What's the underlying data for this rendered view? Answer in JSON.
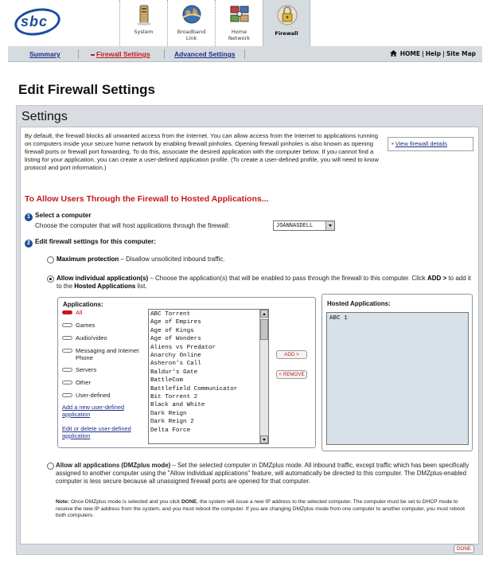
{
  "brand": {
    "logo_text": "sbc"
  },
  "topnav": {
    "items": [
      {
        "label": "System",
        "icon": "system-tower-icon"
      },
      {
        "label": "Broadband\nLink",
        "icon": "globe-icon"
      },
      {
        "label": "Home\nNetwork",
        "icon": "home-network-icon"
      },
      {
        "label": "Firewall",
        "icon": "padlock-icon",
        "active": true
      }
    ]
  },
  "subnav": {
    "summary": "Summary",
    "firewall_settings": "Firewall Settings",
    "advanced_settings": "Advanced Settings",
    "home": "HOME",
    "help": "Help",
    "site_map": "Site Map"
  },
  "page_title": "Edit Firewall Settings",
  "panel_title": "Settings",
  "intro": "By default, the firewall blocks all unwanted access from the Internet. You can allow access from the Internet to applications running on computers inside your secure home network by enabling firewall pinholes. Opening firewall pinholes is also known as opening firewall ports or firewall port forwarding. To do this, associate the desired application with the computer below. If you cannot find a listing for your application, you can create a user-defined application profile. (To create a user-defined profile, you will need to know protocol and port information.)",
  "view_details_link": "View firewall details",
  "section_heading": "To Allow Users Through the Firewall to Hosted Applications...",
  "step1": {
    "number": "1",
    "title": "Select a computer",
    "desc": "Choose the computer that will host applications through the firewall:",
    "selected_computer": "JOANNASDELL"
  },
  "step2": {
    "number": "2",
    "title": "Edit firewall settings for this computer:"
  },
  "options": {
    "max_protection": {
      "title": "Maximum protection",
      "desc": " – Disallow unsolicited inbound traffic."
    },
    "individual": {
      "title": "Allow individual application(s)",
      "desc": " – Choose the application(s) that will be enabled to pass through the firewall to this computer. Click ",
      "add_word": "ADD >",
      "desc2": " to add it to the ",
      "hosted_word": "Hosted Applications",
      "desc3": " list."
    },
    "dmz": {
      "title": "Allow all applications (DMZplus mode)",
      "desc": " – Set the selected computer in DMZplus mode. All inbound traffic, except traffic which has been specifically assigned to another computer using the \"Allow individual applications\" feature, will automatically be directed to this computer. The DMZplus-enabled computer is less secure because all unassigned firewall ports are opened for that computer."
    }
  },
  "applications": {
    "label": "Applications:",
    "categories": [
      {
        "label": "All",
        "selected": true
      },
      {
        "label": "Games"
      },
      {
        "label": "Audio/video"
      },
      {
        "label": "Messaging and Internet Phone"
      },
      {
        "label": "Servers"
      },
      {
        "label": "Other"
      },
      {
        "label": "User-defined"
      }
    ],
    "add_link": "Add a new user-defined application",
    "edit_link": "Edit or delete user-defined application",
    "list": [
      "ABC Torrent",
      "Age of Empires",
      "Age of Kings",
      "Age of Wonders",
      "Aliens vs Predator",
      "Anarchy Online",
      "Asheron's Call",
      "Baldur's Gate",
      "BattleCom",
      "Battlefield Communicator",
      "Bit Torrent 2",
      "Black and White",
      "Dark Reign",
      "Dark Reign 2",
      "Delta Force"
    ]
  },
  "buttons": {
    "add": "ADD >",
    "remove": "< REMOVE",
    "done": "DONE"
  },
  "hosted": {
    "label": "Hosted Applications:",
    "list": [
      "ABC 1"
    ]
  },
  "note": {
    "label": "Note:",
    "text_a": " Once DMZplus mode is selected and you click ",
    "done_word": "DONE",
    "text_b": ", the system will issue a new IP address to the selected computer. The computer must be set to DHCP mode to receive the new IP address from the system, and you must reboot the computer. If you are changing DMZplus mode from one computer to another computer, you must reboot both computers."
  },
  "colors": {
    "accent_red": "#c51a1a",
    "link_blue": "#1d2f8a",
    "brand_blue": "#1c4f9c",
    "panel_grey": "#d9dce0"
  }
}
